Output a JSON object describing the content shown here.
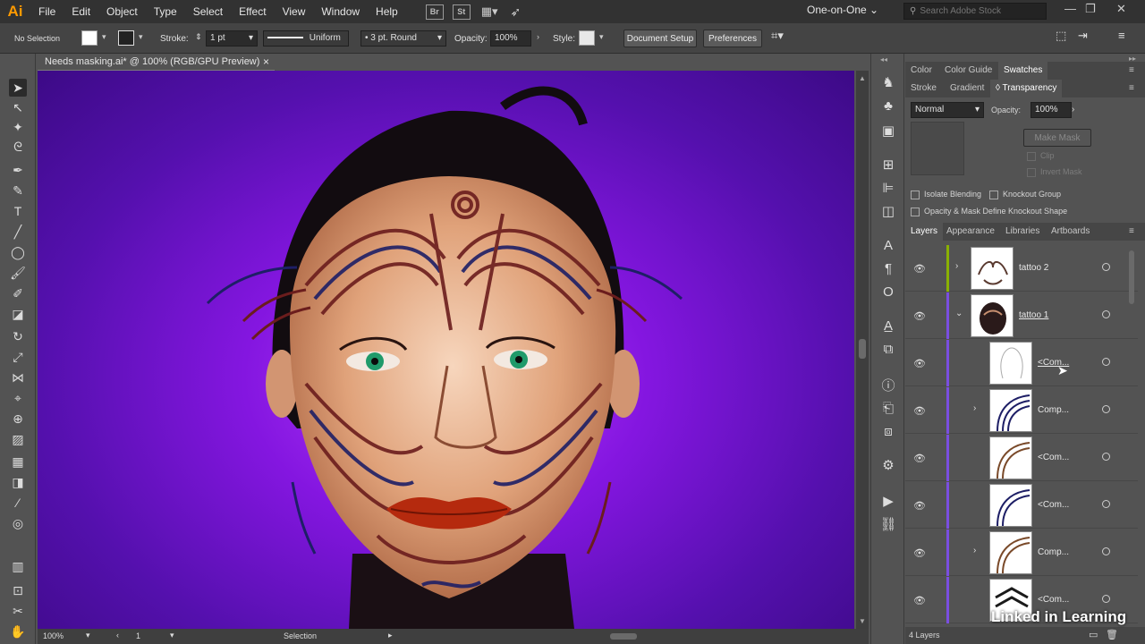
{
  "app": {
    "logo": "Ai",
    "workspace": "One-on-One",
    "search_placeholder": "Search Adobe Stock",
    "bridge_label": "Br",
    "stock_label": "St"
  },
  "menu": [
    "File",
    "Edit",
    "Object",
    "Type",
    "Select",
    "Effect",
    "View",
    "Window",
    "Help"
  ],
  "control_bar": {
    "selection": "No Selection",
    "stroke_label": "Stroke:",
    "stroke_weight": "1 pt",
    "profile": "Uniform",
    "brush": "3 pt. Round",
    "opacity_label": "Opacity:",
    "opacity_value": "100%",
    "style_label": "Style:",
    "document_setup": "Document Setup",
    "preferences": "Preferences"
  },
  "document": {
    "tab_title": "Needs masking.ai* @ 100% (RGB/GPU Preview)",
    "close_icon": "×"
  },
  "status_bar": {
    "zoom": "100%",
    "artboard": "1",
    "tool": "Selection"
  },
  "panels": {
    "top_tabs": [
      "Color",
      "Color Guide",
      "Swatches"
    ],
    "second_tabs": [
      "Stroke",
      "Gradient",
      "Transparency"
    ],
    "transparency": {
      "blend_mode": "Normal",
      "opacity_label": "Opacity:",
      "opacity": "100%",
      "make_mask": "Make Mask",
      "clip": "Clip",
      "invert_mask": "Invert Mask",
      "isolate_blending": "Isolate Blending",
      "knockout_group": "Knockout Group",
      "opacity_mask_knockout": "Opacity & Mask Define Knockout Shape"
    },
    "layers_tabs": [
      "Layers",
      "Appearance",
      "Libraries",
      "Artboards"
    ],
    "layers": [
      {
        "name": "tattoo 2",
        "expander": "›"
      },
      {
        "name": "tattoo 1",
        "expander": "⌄"
      },
      {
        "name": "<Com...",
        "expander": ""
      },
      {
        "name": "Comp...",
        "expander": "›"
      },
      {
        "name": "<Com...",
        "expander": ""
      },
      {
        "name": "<Com...",
        "expander": ""
      },
      {
        "name": "Comp...",
        "expander": "›"
      },
      {
        "name": "<Com...",
        "expander": ""
      }
    ],
    "layers_count": "4 Layers"
  },
  "watermark": "Linked in Learning",
  "colors": {
    "accent_green": "#8ab000",
    "accent_purple": "#7a4ee0",
    "canvas_purple": "#8416e0"
  }
}
